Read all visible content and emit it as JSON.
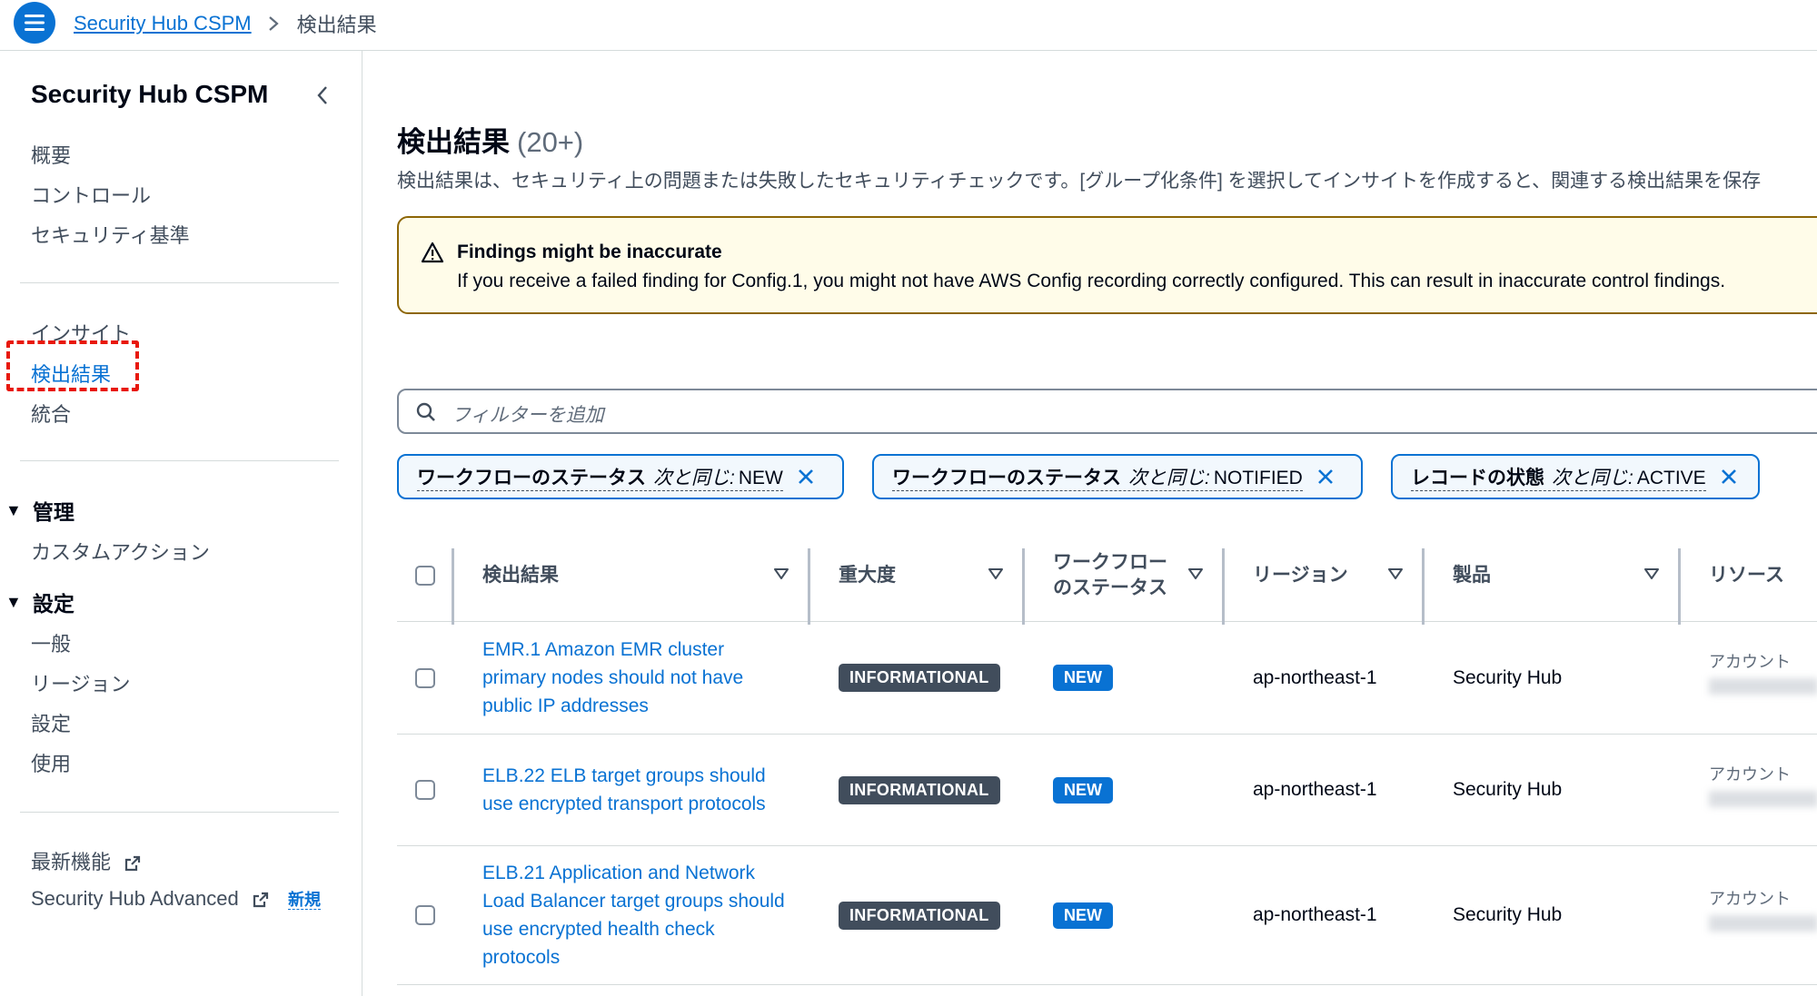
{
  "breadcrumb": {
    "service": "Security Hub CSPM",
    "current": "検出結果"
  },
  "sidebar": {
    "title": "Security Hub CSPM",
    "group1": [
      "概要",
      "コントロール",
      "セキュリティ基準"
    ],
    "group2": [
      "インサイト",
      "検出結果",
      "統合"
    ],
    "active_item": "検出結果",
    "section_manage": {
      "label": "管理",
      "items": [
        "カスタムアクション"
      ]
    },
    "section_settings": {
      "label": "設定",
      "items": [
        "一般",
        "リージョン",
        "設定",
        "使用"
      ]
    },
    "footer": {
      "whats_new": "最新機能",
      "advanced": "Security Hub Advanced",
      "new_badge": "新規"
    }
  },
  "page": {
    "title": "検出結果",
    "count": "(20+)",
    "description": "検出結果は、セキュリティ上の問題または失敗したセキュリティチェックです。[グループ化条件] を選択してインサイトを作成すると、関連する検出結果を保存"
  },
  "alert": {
    "title": "Findings might be inaccurate",
    "text": "If you receive a failed finding for Config.1, you might not have AWS Config recording correctly configured. This can result in inaccurate control findings."
  },
  "search": {
    "placeholder": "フィルターを追加"
  },
  "filters": [
    {
      "key": "ワークフローのステータス",
      "op": "次と同じ:",
      "value": "NEW"
    },
    {
      "key": "ワークフローのステータス",
      "op": "次と同じ:",
      "value": "NOTIFIED"
    },
    {
      "key": "レコードの状態",
      "op": "次と同じ:",
      "value": "ACTIVE"
    }
  ],
  "table": {
    "columns": {
      "finding": "検出結果",
      "severity": "重大度",
      "workflow_line1": "ワークフロー",
      "workflow_line2": "のステータス",
      "region": "リージョン",
      "product": "製品",
      "resource": "リソース"
    },
    "rows": [
      {
        "finding": "EMR.1 Amazon EMR cluster primary nodes should not have public IP addresses",
        "severity": "INFORMATIONAL",
        "workflow": "NEW",
        "region": "ap-northeast-1",
        "product": "Security Hub",
        "resource_label": "アカウント"
      },
      {
        "finding": "ELB.22 ELB target groups should use encrypted transport protocols",
        "severity": "INFORMATIONAL",
        "workflow": "NEW",
        "region": "ap-northeast-1",
        "product": "Security Hub",
        "resource_label": "アカウント"
      },
      {
        "finding": "ELB.21 Application and Network Load Balancer target groups should use encrypted health check protocols",
        "severity": "INFORMATIONAL",
        "workflow": "NEW",
        "region": "ap-northeast-1",
        "product": "Security Hub",
        "resource_label": "アカウント"
      }
    ]
  },
  "colors": {
    "accent": "#0972d3",
    "warning_border": "#8d6605",
    "warning_bg": "#fffce9",
    "severity_badge": "#414d5c",
    "highlight": "#e8180c"
  }
}
